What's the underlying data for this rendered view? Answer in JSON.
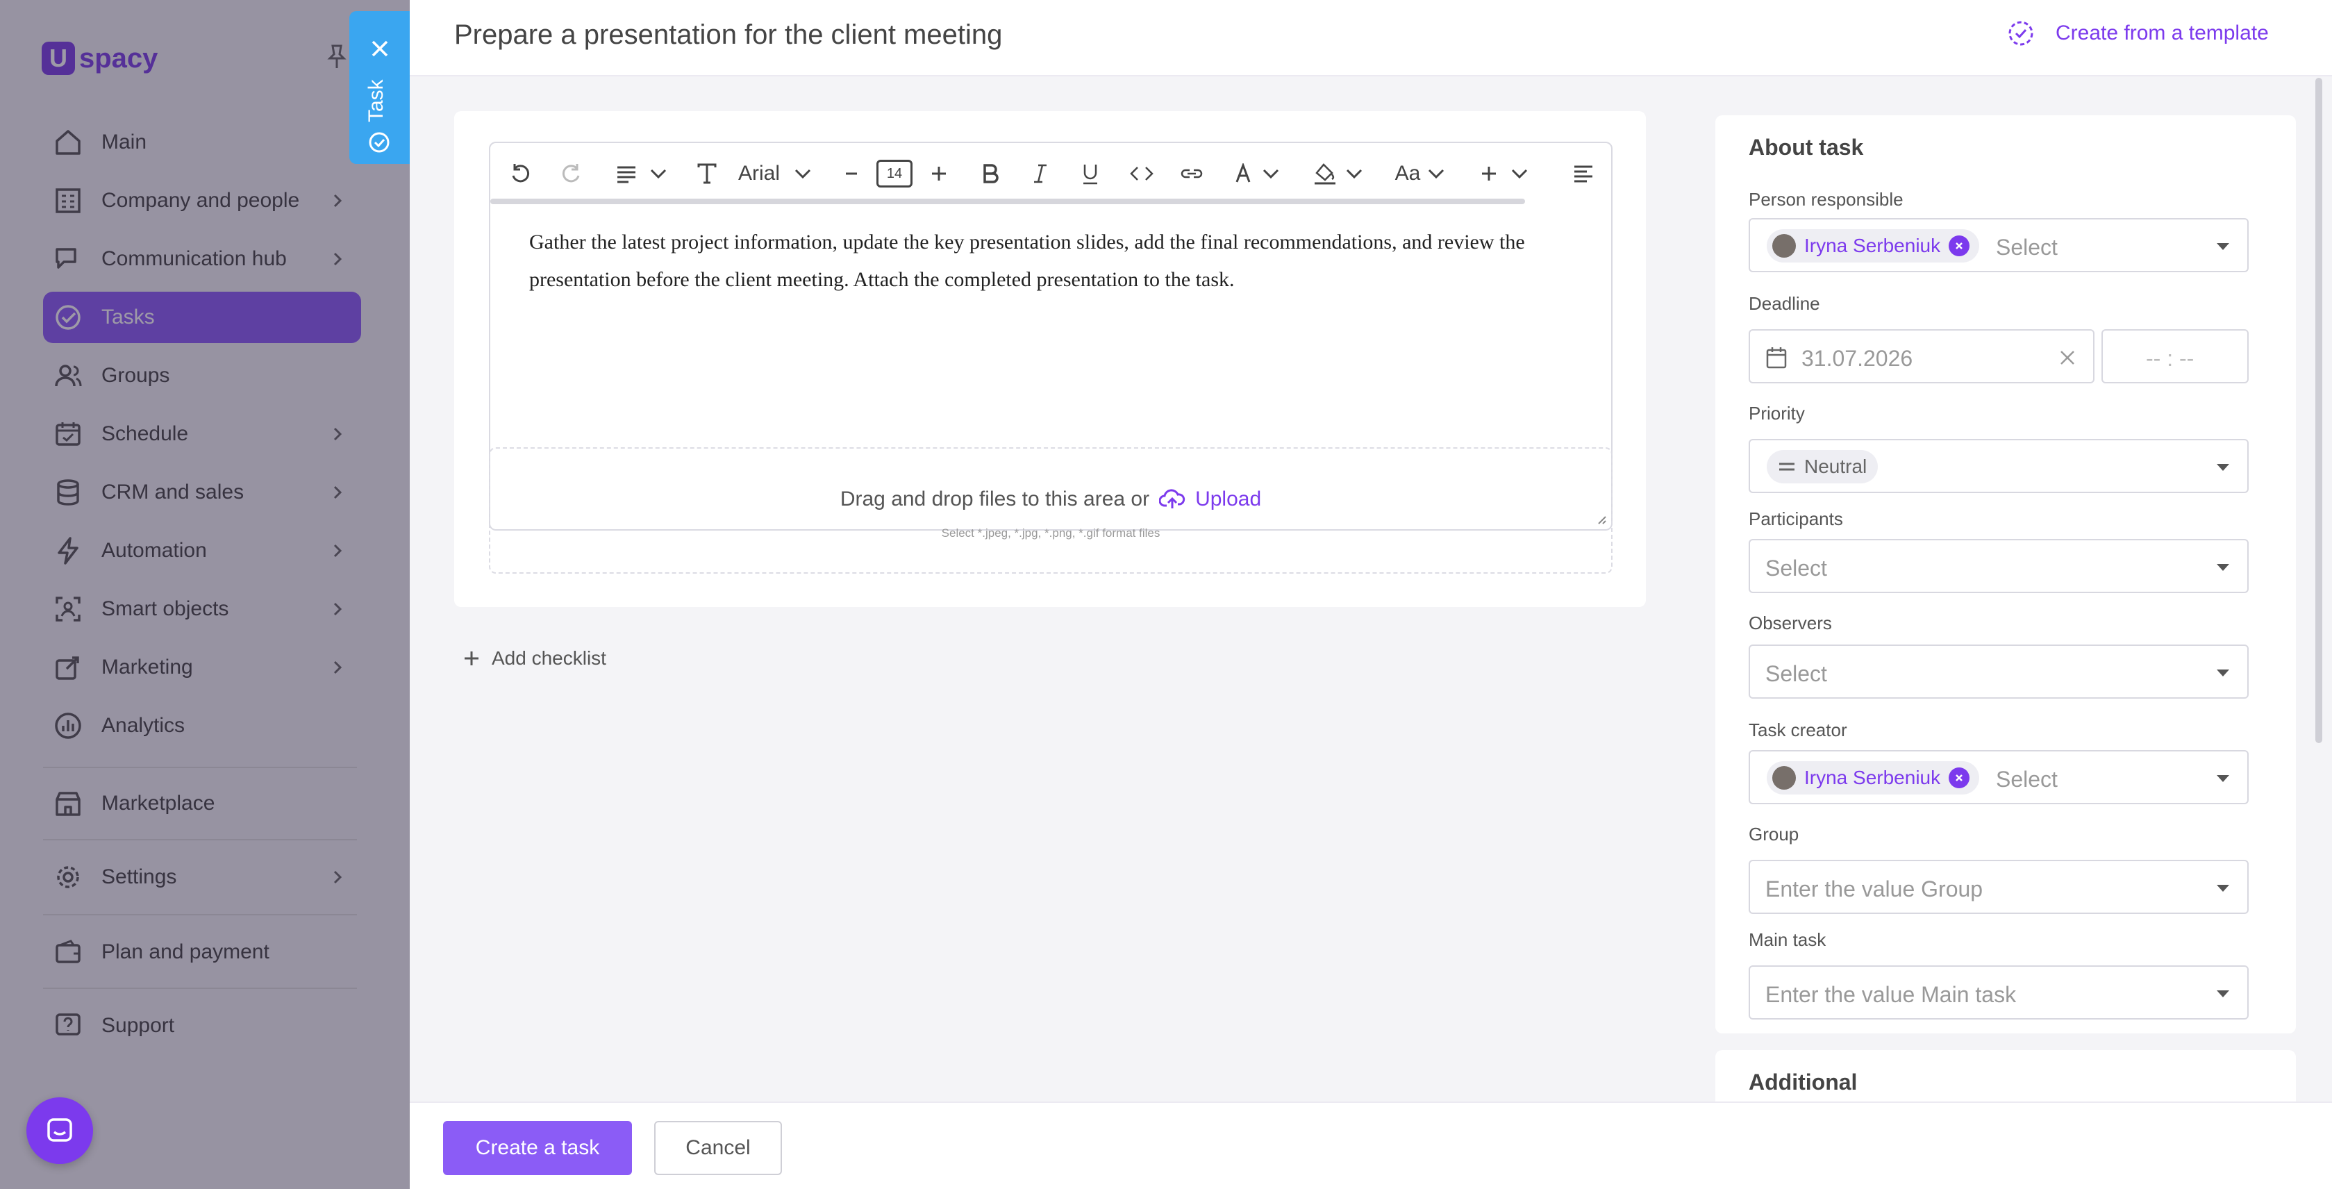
{
  "app": {
    "logo_mark": "U",
    "logo_word": "spacy"
  },
  "sidebar": {
    "items": [
      {
        "label": "Main",
        "icon": "home-icon"
      },
      {
        "label": "Company and people",
        "icon": "building-icon"
      },
      {
        "label": "Communication hub",
        "icon": "chat-edit-icon"
      },
      {
        "label": "Tasks",
        "icon": "check-circle-icon"
      },
      {
        "label": "Groups",
        "icon": "users-icon"
      },
      {
        "label": "Schedule",
        "icon": "calendar-icon"
      },
      {
        "label": "CRM and sales",
        "icon": "database-icon"
      },
      {
        "label": "Automation",
        "icon": "lightning-icon"
      },
      {
        "label": "Smart objects",
        "icon": "scan-icon"
      },
      {
        "label": "Marketing",
        "icon": "marketing-icon"
      },
      {
        "label": "Analytics",
        "icon": "chart-icon"
      },
      {
        "label": "Marketplace",
        "icon": "store-icon"
      },
      {
        "label": "Settings",
        "icon": "gear-icon"
      },
      {
        "label": "Plan and payment",
        "icon": "wallet-icon"
      },
      {
        "label": "Support",
        "icon": "help-icon"
      }
    ],
    "active": "Tasks"
  },
  "task_tab": {
    "label": "Task"
  },
  "header": {
    "title": "Prepare a presentation for the client meeting",
    "template_link": "Create from a template"
  },
  "editor": {
    "toolbar": {
      "font": "Arial",
      "font_size": "14",
      "case_label": "Aa"
    },
    "content": "Gather the latest project information, update the key presentation slides, add the final recommendations, and review the presentation before the client meeting. Attach the completed presentation to the task."
  },
  "upload": {
    "text": "Drag and drop files to this area or",
    "link": "Upload",
    "hint": "Select *.jpeg, *.jpg, *.png, *.gif format files"
  },
  "checklist": {
    "add_label": "Add checklist"
  },
  "about": {
    "title": "About task",
    "person_responsible": {
      "label": "Person responsible",
      "value": "Iryna Serbeniuk",
      "placeholder": "Select"
    },
    "deadline": {
      "label": "Deadline",
      "date": "31.07.2026",
      "time_placeholder": "-- : --"
    },
    "priority": {
      "label": "Priority",
      "value": "Neutral"
    },
    "participants": {
      "label": "Participants",
      "placeholder": "Select"
    },
    "observers": {
      "label": "Observers",
      "placeholder": "Select"
    },
    "task_creator": {
      "label": "Task creator",
      "value": "Iryna Serbeniuk",
      "placeholder": "Select"
    },
    "group": {
      "label": "Group",
      "placeholder": "Enter the value Group"
    },
    "main_task": {
      "label": "Main task",
      "placeholder": "Enter the value Main task"
    }
  },
  "additional": {
    "title": "Additional"
  },
  "footer": {
    "create_label": "Create a task",
    "cancel_label": "Cancel"
  },
  "colors": {
    "accent": "#8b5cf6",
    "accent_text": "#7c3aed",
    "task_tab": "#3aa6f0"
  }
}
